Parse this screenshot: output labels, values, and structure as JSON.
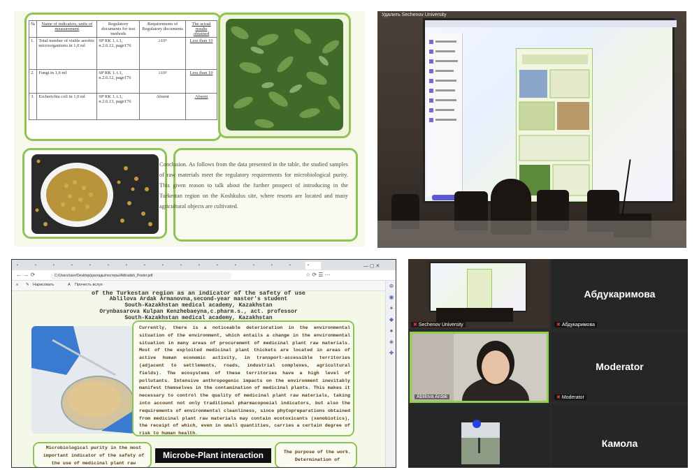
{
  "panel1": {
    "table": {
      "headers": [
        "№",
        "Name of indicators, units of measurement",
        "Regulatory documents for test methods",
        "Requirements of Regulatory documents",
        "The actual results obtained"
      ],
      "rows": [
        {
          "n": "1.",
          "name": "Total number of viable aerobic microorganisms in 1,0 ml",
          "doc": "SP RK 1. t.1, n.2.6.12, page176",
          "req": "≥10⁵",
          "res": "Less than 10"
        },
        {
          "n": "2.",
          "name": "Fungi in 1,0 ml",
          "doc": "SP RK 1. t.1, n.2.6.12, page176",
          "req": "≥10²",
          "res": "Less than 10"
        },
        {
          "n": "3.",
          "name": "Escherichia coli in 1,0 ml",
          "doc": "SP RK 1. t.1, n.2.6.13, page176",
          "req": "Absent",
          "res": "Absent"
        }
      ]
    },
    "conclusion": "Conclusion. As follows from the data presented in the table, the studied samples of raw materials meet the regulatory requirements for microbiological purity. This given reason to talk about the further prospect of introducing in the Turkestan region on the Koshkulus site, where resorts are located and many agricultural objects are cultivated."
  },
  "panel2": {
    "label": "Удалить Sechenov University"
  },
  "panel3": {
    "url": "C:/Users/user/Desktop/доклады/постеры/Ablivalish_Poster.pdf",
    "pdf_toolbar": {
      "draw": "Нарисовать",
      "read": "Прочесть вслух"
    },
    "header_lines": [
      "of the Turkestan region as an indicator of the safety of use",
      "Ablilova Ardak Armanovna,second-year master's student",
      "South-Kazakhstan medical academy, Kazakhstan",
      "Orynbasarova Kulpan Kenzhebaeyna,c.pharm.s., act. professor",
      "South-Kazakhstan medical academy, Kazakhstan"
    ],
    "intro": "Currently, there is a noticeable deterioration in the environmental situation of the environment, which entails a change in the environmental situation in many areas of procurement of medicinal plant raw materials. Most of the exploited medicinal plant thickets are located in areas of active human economic activity, in transport-accessible territories (adjacent to settlements, roads, industrial complexes, agricultural fields). The ecosystems of these territories have a high level of pollutants. Intensive anthropogenic impacts on the environment inevitably manifest themselves in the contamination of medicinal plants. This makes it necessary to control the quality of medicinal plant raw materials, taking into account not only traditional pharmacopoeial indicators, but also the requirements of environmental cleanliness, since phytopreparations obtained from medicinal plant raw materials may contain ecotoxicants (xenobiotics), the receipt of which, even in small quantities, carries a certain degree of risk to human health.",
    "micro_text": "Microbiological purity in the most important indicator of the safety of the use of medicinal plant raw materials",
    "purpose_text": "The purpose of the work. Determination of",
    "caption": "Microbe-Plant interaction"
  },
  "panel4": {
    "participants": [
      {
        "title": "Абдукаримова",
        "label": "Абдукаримова"
      },
      {
        "title": "Moderator",
        "label": "Moderator"
      },
      {
        "title": "Камола",
        "label": ""
      }
    ],
    "sechenov_label": "Sechenov University",
    "speaker_label": "Ablilova Ardak"
  }
}
